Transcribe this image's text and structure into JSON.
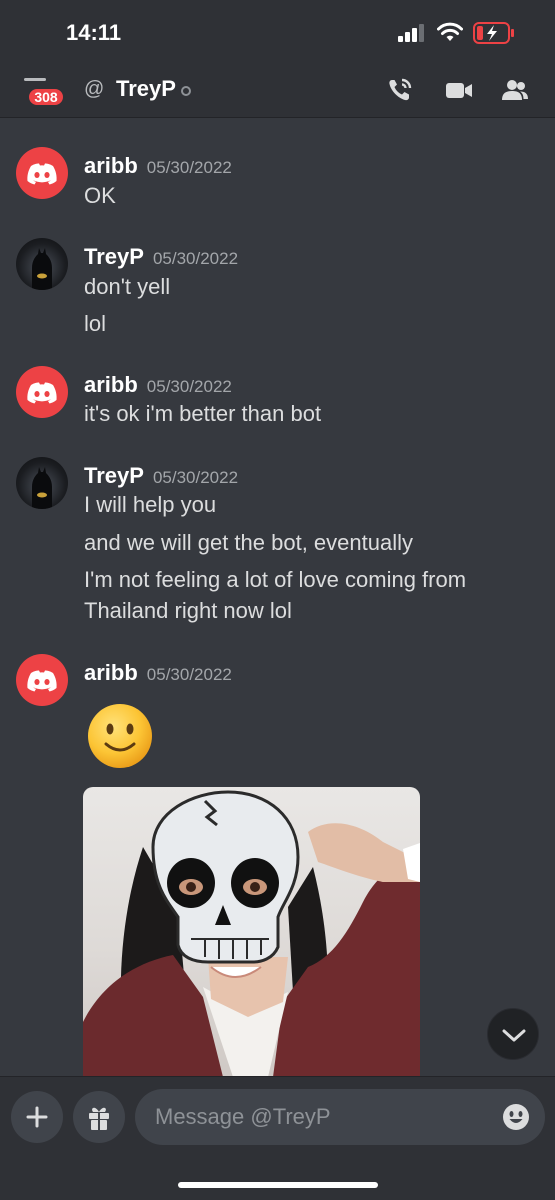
{
  "status_bar": {
    "time": "14:11"
  },
  "header": {
    "badge_count": "308",
    "at_symbol": "@",
    "title": "TreyP",
    "icons": [
      "menu-icon",
      "phone-call-icon",
      "video-call-icon",
      "members-icon"
    ]
  },
  "messages": [
    {
      "username": "aribb",
      "timestamp": "05/30/2022",
      "avatar": "discord-logo",
      "lines": [
        "OK"
      ]
    },
    {
      "username": "TreyP",
      "timestamp": "05/30/2022",
      "avatar": "batman-photo",
      "lines": [
        "don't yell",
        "lol"
      ]
    },
    {
      "username": "aribb",
      "timestamp": "05/30/2022",
      "avatar": "discord-logo",
      "lines": [
        "it's ok i'm better than bot"
      ]
    },
    {
      "username": "TreyP",
      "timestamp": "05/30/2022",
      "avatar": "batman-photo",
      "lines": [
        "I will help you",
        "and we will get the bot, eventually",
        "I'm not feeling a lot of love coming from",
        "Thailand right now lol"
      ]
    },
    {
      "username": "aribb",
      "timestamp": "05/30/2022",
      "avatar": "discord-logo",
      "lines": [],
      "emoji": "slightly-smiling-face",
      "attachment": "photo-with-skull-mask-sticker"
    }
  ],
  "composer": {
    "placeholder": "Message @TreyP",
    "icons": [
      "plus-icon",
      "gift-icon",
      "emoji-icon"
    ]
  },
  "colors": {
    "background": "#36393f",
    "header": "#2f3136",
    "accent_red": "#ed4245",
    "input": "#40444b"
  }
}
